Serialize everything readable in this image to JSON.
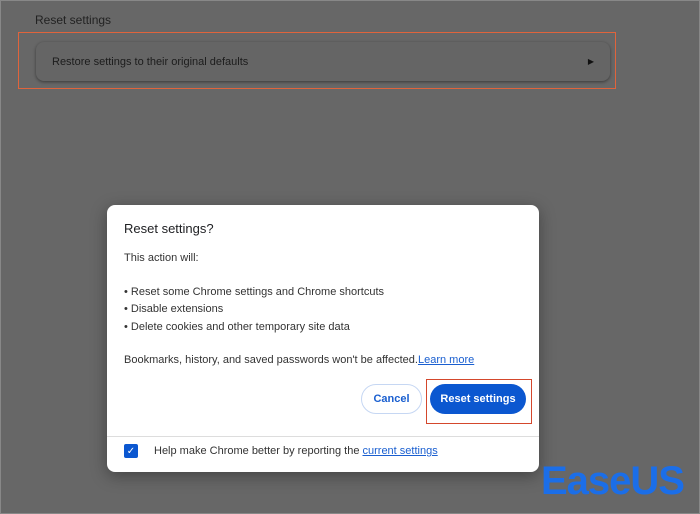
{
  "page": {
    "section_title": "Reset settings",
    "restore_row": "Restore settings to their original defaults"
  },
  "dialog": {
    "title": "Reset settings?",
    "intro": "This action will:",
    "bullets": [
      "• Reset some Chrome settings and Chrome shortcuts",
      "• Disable extensions",
      "• Delete cookies and other temporary site data"
    ],
    "note": "Bookmarks, history, and saved passwords won't be affected.",
    "learn_more": "Learn more",
    "cancel": "Cancel",
    "reset": "Reset settings",
    "report_text": "Help make Chrome better by reporting the ",
    "report_link": "current settings",
    "report_checked": true
  },
  "watermark": "EaseUS",
  "colors": {
    "accent": "#0b57d0",
    "highlight": "#e0643c"
  }
}
